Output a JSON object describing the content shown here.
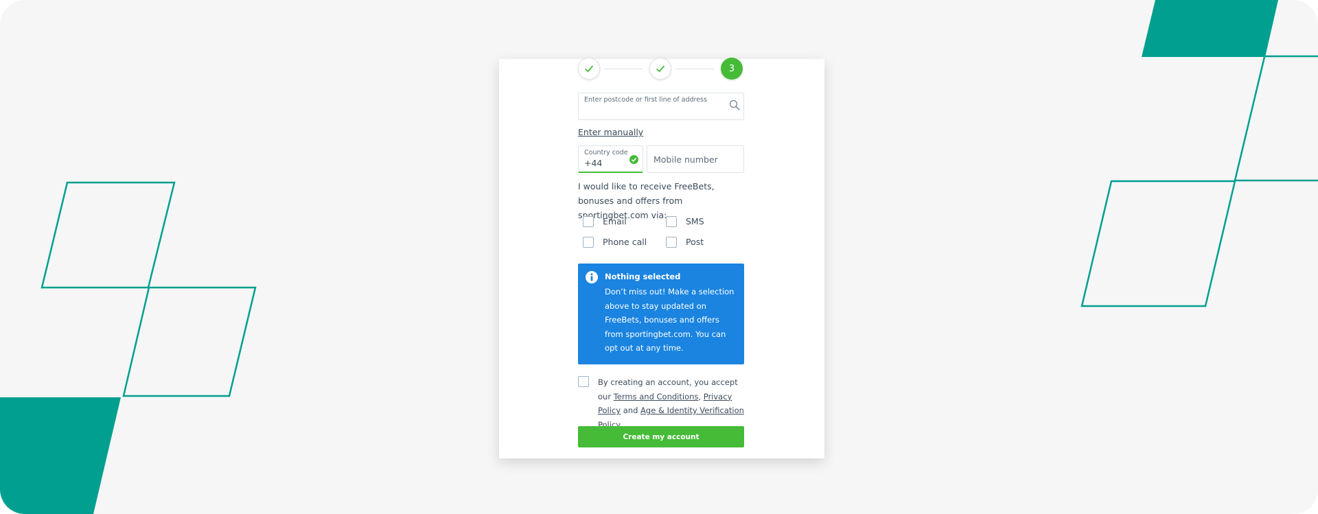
{
  "stepper": {
    "steps": [
      {
        "state": "complete",
        "icon": "check-icon"
      },
      {
        "state": "complete",
        "icon": "check-icon"
      },
      {
        "state": "current",
        "label": "3"
      }
    ]
  },
  "address": {
    "placeholder": "Enter postcode or first line of address",
    "icon": "search-icon",
    "enter_manually_label": "Enter manually"
  },
  "phone": {
    "country_code_label": "Country code",
    "country_code_value": "+44",
    "country_code_status": "valid",
    "mobile_placeholder": "Mobile number"
  },
  "marketing": {
    "prompt": "I would like to receive FreeBets, bonuses and offers from sportingbet.com via:",
    "options": [
      {
        "label": "Email",
        "checked": false
      },
      {
        "label": "SMS",
        "checked": false
      },
      {
        "label": "Phone call",
        "checked": false
      },
      {
        "label": "Post",
        "checked": false
      }
    ]
  },
  "info_box": {
    "icon": "info-icon",
    "title": "Nothing selected",
    "body": "Don’t miss out! Make a selection above to stay updated on FreeBets, bonuses and offers from sportingbet.com. You can opt out at any time."
  },
  "terms": {
    "checked": false,
    "prefix": "By creating an account, you accept our ",
    "terms_link": "Terms and Conditions",
    "sep": ", ",
    "privacy_link": "Privacy Policy",
    "and": " and ",
    "age_link": "Age & Identity Verification Policy."
  },
  "submit": {
    "label": "Create my account"
  },
  "colors": {
    "brand_teal": "#009f8f",
    "success_green": "#45bb38",
    "info_blue": "#1a84e0",
    "text": "#3b4b5b",
    "background": "#f6f6f6"
  }
}
